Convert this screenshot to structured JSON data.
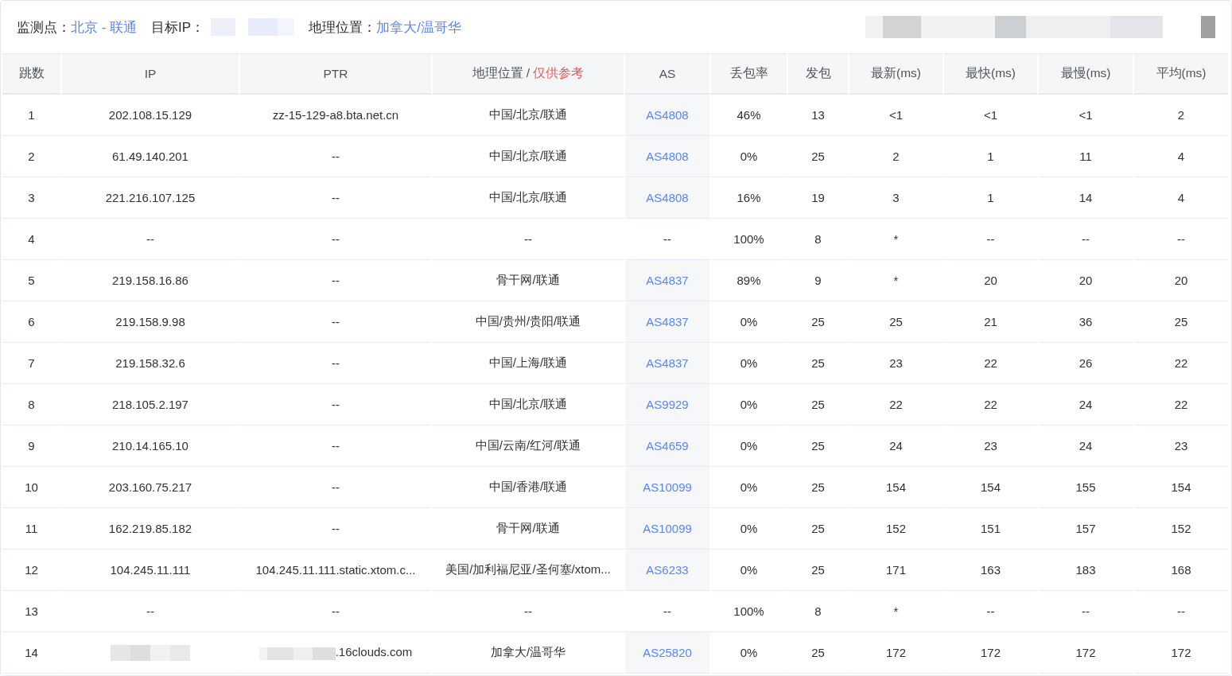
{
  "summary": {
    "probe_label": "监测点：",
    "probe_value": "北京 - 联通",
    "target_label": "目标IP：",
    "target_redacted": true,
    "geo_label": "地理位置：",
    "geo_value": "加拿大/温哥华",
    "corner_redacted": true
  },
  "table": {
    "columns": [
      {
        "label": "跳数"
      },
      {
        "label": "IP"
      },
      {
        "label": "PTR"
      },
      {
        "label": "地理位置 / ",
        "note": "仅供参考"
      },
      {
        "label": "AS"
      },
      {
        "label": "丢包率"
      },
      {
        "label": "发包"
      },
      {
        "label": "最新(ms)"
      },
      {
        "label": "最快(ms)"
      },
      {
        "label": "最慢(ms)"
      },
      {
        "label": "平均(ms)"
      }
    ],
    "rows": [
      {
        "hop": "1",
        "ip": "202.108.15.129",
        "ptr": "zz-15-129-a8.bta.net.cn",
        "geo": "中国/北京/联通",
        "as": "AS4808",
        "as_link": true,
        "loss": "46%",
        "sent": "13",
        "last": "<1",
        "best": "<1",
        "worst": "<1",
        "avg": "2"
      },
      {
        "hop": "2",
        "ip": "61.49.140.201",
        "ptr": "--",
        "geo": "中国/北京/联通",
        "as": "AS4808",
        "as_link": true,
        "loss": "0%",
        "sent": "25",
        "last": "2",
        "best": "1",
        "worst": "11",
        "avg": "4"
      },
      {
        "hop": "3",
        "ip": "221.216.107.125",
        "ptr": "--",
        "geo": "中国/北京/联通",
        "as": "AS4808",
        "as_link": true,
        "loss": "16%",
        "sent": "19",
        "last": "3",
        "best": "1",
        "worst": "14",
        "avg": "4"
      },
      {
        "hop": "4",
        "ip": "--",
        "ptr": "--",
        "geo": "--",
        "as": "--",
        "as_link": false,
        "loss": "100%",
        "sent": "8",
        "last": "*",
        "best": "--",
        "worst": "--",
        "avg": "--"
      },
      {
        "hop": "5",
        "ip": "219.158.16.86",
        "ptr": "--",
        "geo": "骨干网/联通",
        "as": "AS4837",
        "as_link": true,
        "loss": "89%",
        "sent": "9",
        "last": "*",
        "best": "20",
        "worst": "20",
        "avg": "20"
      },
      {
        "hop": "6",
        "ip": "219.158.9.98",
        "ptr": "--",
        "geo": "中国/贵州/贵阳/联通",
        "as": "AS4837",
        "as_link": true,
        "loss": "0%",
        "sent": "25",
        "last": "25",
        "best": "21",
        "worst": "36",
        "avg": "25"
      },
      {
        "hop": "7",
        "ip": "219.158.32.6",
        "ptr": "--",
        "geo": "中国/上海/联通",
        "as": "AS4837",
        "as_link": true,
        "loss": "0%",
        "sent": "25",
        "last": "23",
        "best": "22",
        "worst": "26",
        "avg": "22"
      },
      {
        "hop": "8",
        "ip": "218.105.2.197",
        "ptr": "--",
        "geo": "中国/北京/联通",
        "as": "AS9929",
        "as_link": true,
        "loss": "0%",
        "sent": "25",
        "last": "22",
        "best": "22",
        "worst": "24",
        "avg": "22"
      },
      {
        "hop": "9",
        "ip": "210.14.165.10",
        "ptr": "--",
        "geo": "中国/云南/红河/联通",
        "as": "AS4659",
        "as_link": true,
        "loss": "0%",
        "sent": "25",
        "last": "24",
        "best": "23",
        "worst": "24",
        "avg": "23"
      },
      {
        "hop": "10",
        "ip": "203.160.75.217",
        "ptr": "--",
        "geo": "中国/香港/联通",
        "as": "AS10099",
        "as_link": true,
        "loss": "0%",
        "sent": "25",
        "last": "154",
        "best": "154",
        "worst": "155",
        "avg": "154"
      },
      {
        "hop": "11",
        "ip": "162.219.85.182",
        "ptr": "--",
        "geo": "骨干网/联通",
        "as": "AS10099",
        "as_link": true,
        "loss": "0%",
        "sent": "25",
        "last": "152",
        "best": "151",
        "worst": "157",
        "avg": "152"
      },
      {
        "hop": "12",
        "ip": "104.245.11.111",
        "ptr": "104.245.11.111.static.xtom.c...",
        "geo": "美国/加利福尼亚/圣何塞/xtom...",
        "as": "AS6233",
        "as_link": true,
        "loss": "0%",
        "sent": "25",
        "last": "171",
        "best": "163",
        "worst": "183",
        "avg": "168"
      },
      {
        "hop": "13",
        "ip": "--",
        "ptr": "--",
        "geo": "--",
        "as": "--",
        "as_link": false,
        "loss": "100%",
        "sent": "8",
        "last": "*",
        "best": "--",
        "worst": "--",
        "avg": "--"
      },
      {
        "hop": "14",
        "ip_redacted": true,
        "ptr_redacted_prefix": true,
        "ptr": ".16clouds.com",
        "geo": "加拿大/温哥华",
        "as": "AS25820",
        "as_link": true,
        "loss": "0%",
        "sent": "25",
        "last": "172",
        "best": "172",
        "worst": "172",
        "avg": "172"
      }
    ]
  }
}
